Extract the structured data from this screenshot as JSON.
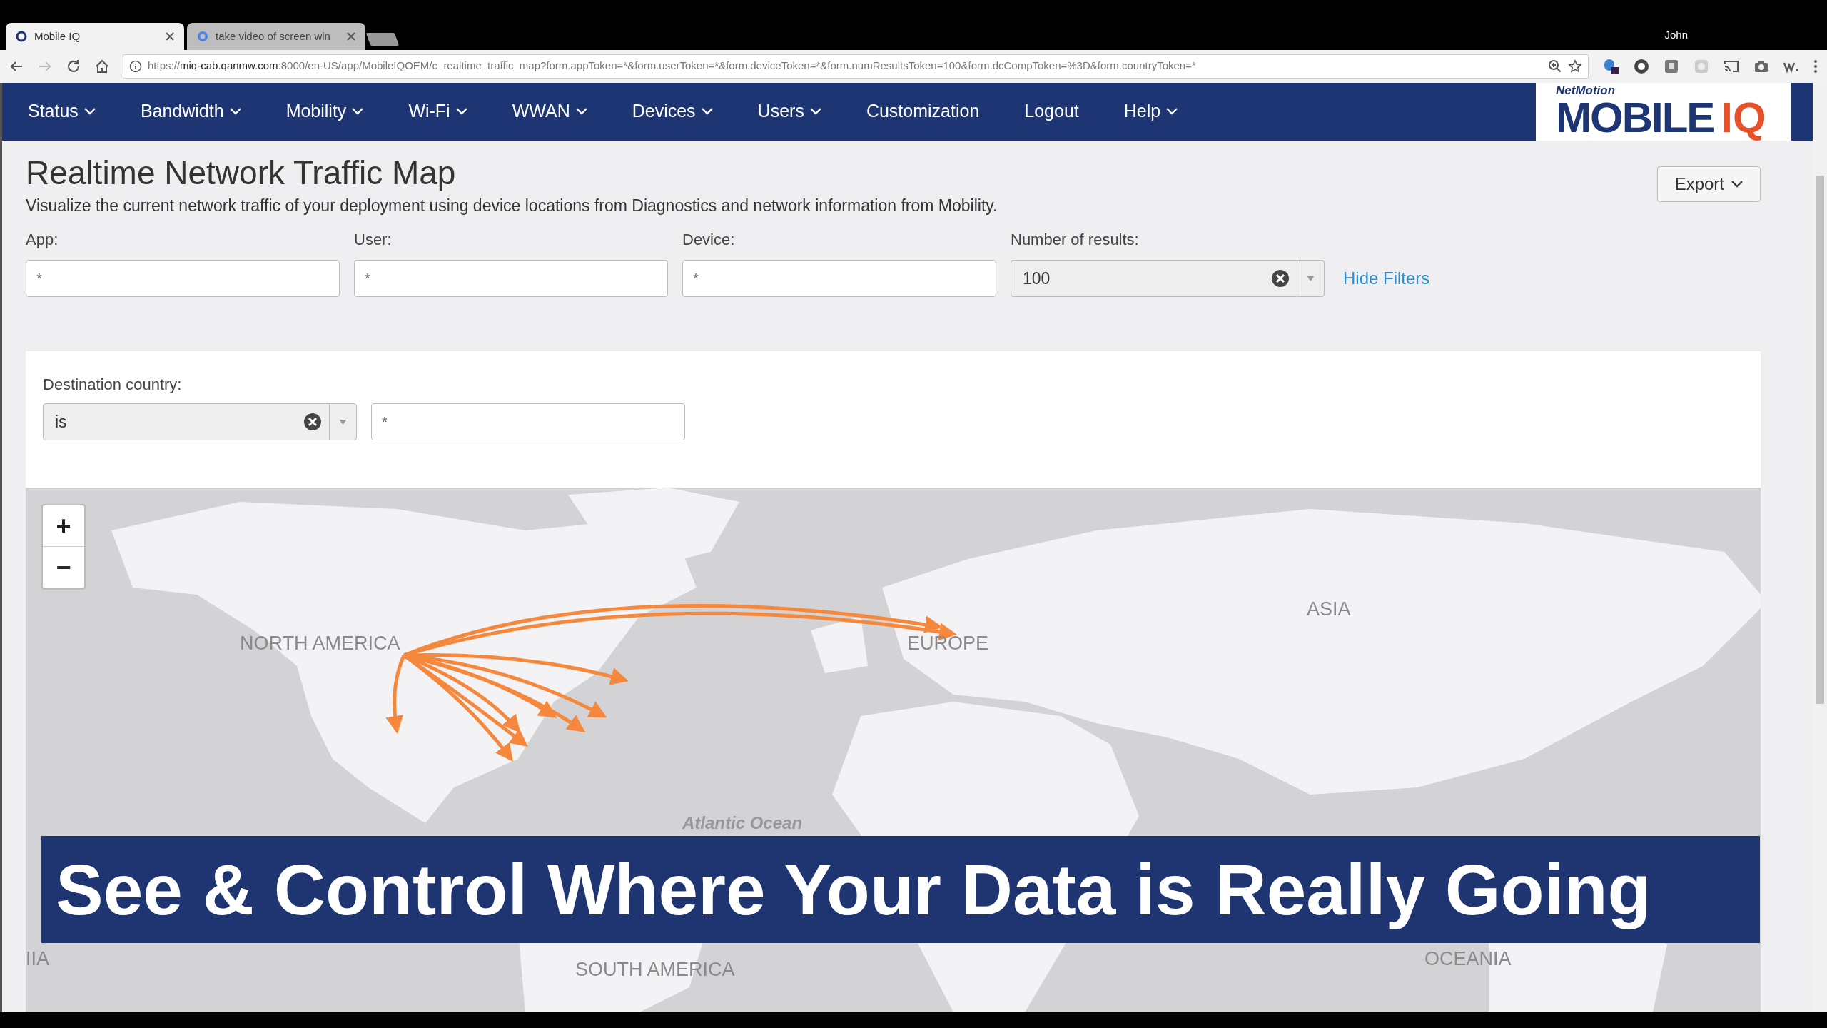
{
  "browser": {
    "tabs": [
      {
        "title": "Mobile IQ",
        "selected": true
      },
      {
        "title": "take video of screen win",
        "selected": false
      }
    ],
    "user": "John",
    "url": {
      "scheme": "https://",
      "host": "miq-cab.qanmw.com",
      "rest": ":8000/en-US/app/MobileIQOEM/c_realtime_traffic_map?form.appToken=*&form.userToken=*&form.deviceToken=*&form.numResultsToken=100&form.dcCompToken=%3D&form.countryToken=*"
    }
  },
  "nav": {
    "items": [
      {
        "label": "Status",
        "dropdown": true
      },
      {
        "label": "Bandwidth",
        "dropdown": true
      },
      {
        "label": "Mobility",
        "dropdown": true
      },
      {
        "label": "Wi-Fi",
        "dropdown": true
      },
      {
        "label": "WWAN",
        "dropdown": true
      },
      {
        "label": "Devices",
        "dropdown": true
      },
      {
        "label": "Users",
        "dropdown": true
      },
      {
        "label": "Customization",
        "dropdown": false
      },
      {
        "label": "Logout",
        "dropdown": false
      },
      {
        "label": "Help",
        "dropdown": true
      }
    ],
    "logo": {
      "top": "NetMotion",
      "main": "MOBILE",
      "accent": "IQ"
    }
  },
  "page": {
    "title": "Realtime Network Traffic Map",
    "description": "Visualize the current network traffic of your deployment using device locations from Diagnostics and network information from Mobility.",
    "export": "Export"
  },
  "filters": [
    {
      "label": "App:",
      "kind": "text",
      "value": "*"
    },
    {
      "label": "User:",
      "kind": "text",
      "value": "*"
    },
    {
      "label": "Device:",
      "kind": "text",
      "value": "*"
    },
    {
      "label": "Number of results:",
      "kind": "select",
      "value": "100"
    }
  ],
  "hide_filters": "Hide Filters",
  "destination": {
    "label": "Destination country:",
    "operator": "is",
    "value": "*"
  },
  "map": {
    "zoom_in": "+",
    "zoom_out": "−",
    "labels": [
      {
        "text": "NORTH AMERICA",
        "kind": "region"
      },
      {
        "text": "EUROPE",
        "kind": "region"
      },
      {
        "text": "ASIA",
        "kind": "region"
      },
      {
        "text": "Atlantic Ocean",
        "kind": "ocean"
      },
      {
        "text": "IIA",
        "kind": "region"
      },
      {
        "text": "SOUTH AMERICA",
        "kind": "region"
      },
      {
        "text": "OCEANIA",
        "kind": "region"
      }
    ]
  },
  "banner": "See & Control Where Your Data is Really Going"
}
